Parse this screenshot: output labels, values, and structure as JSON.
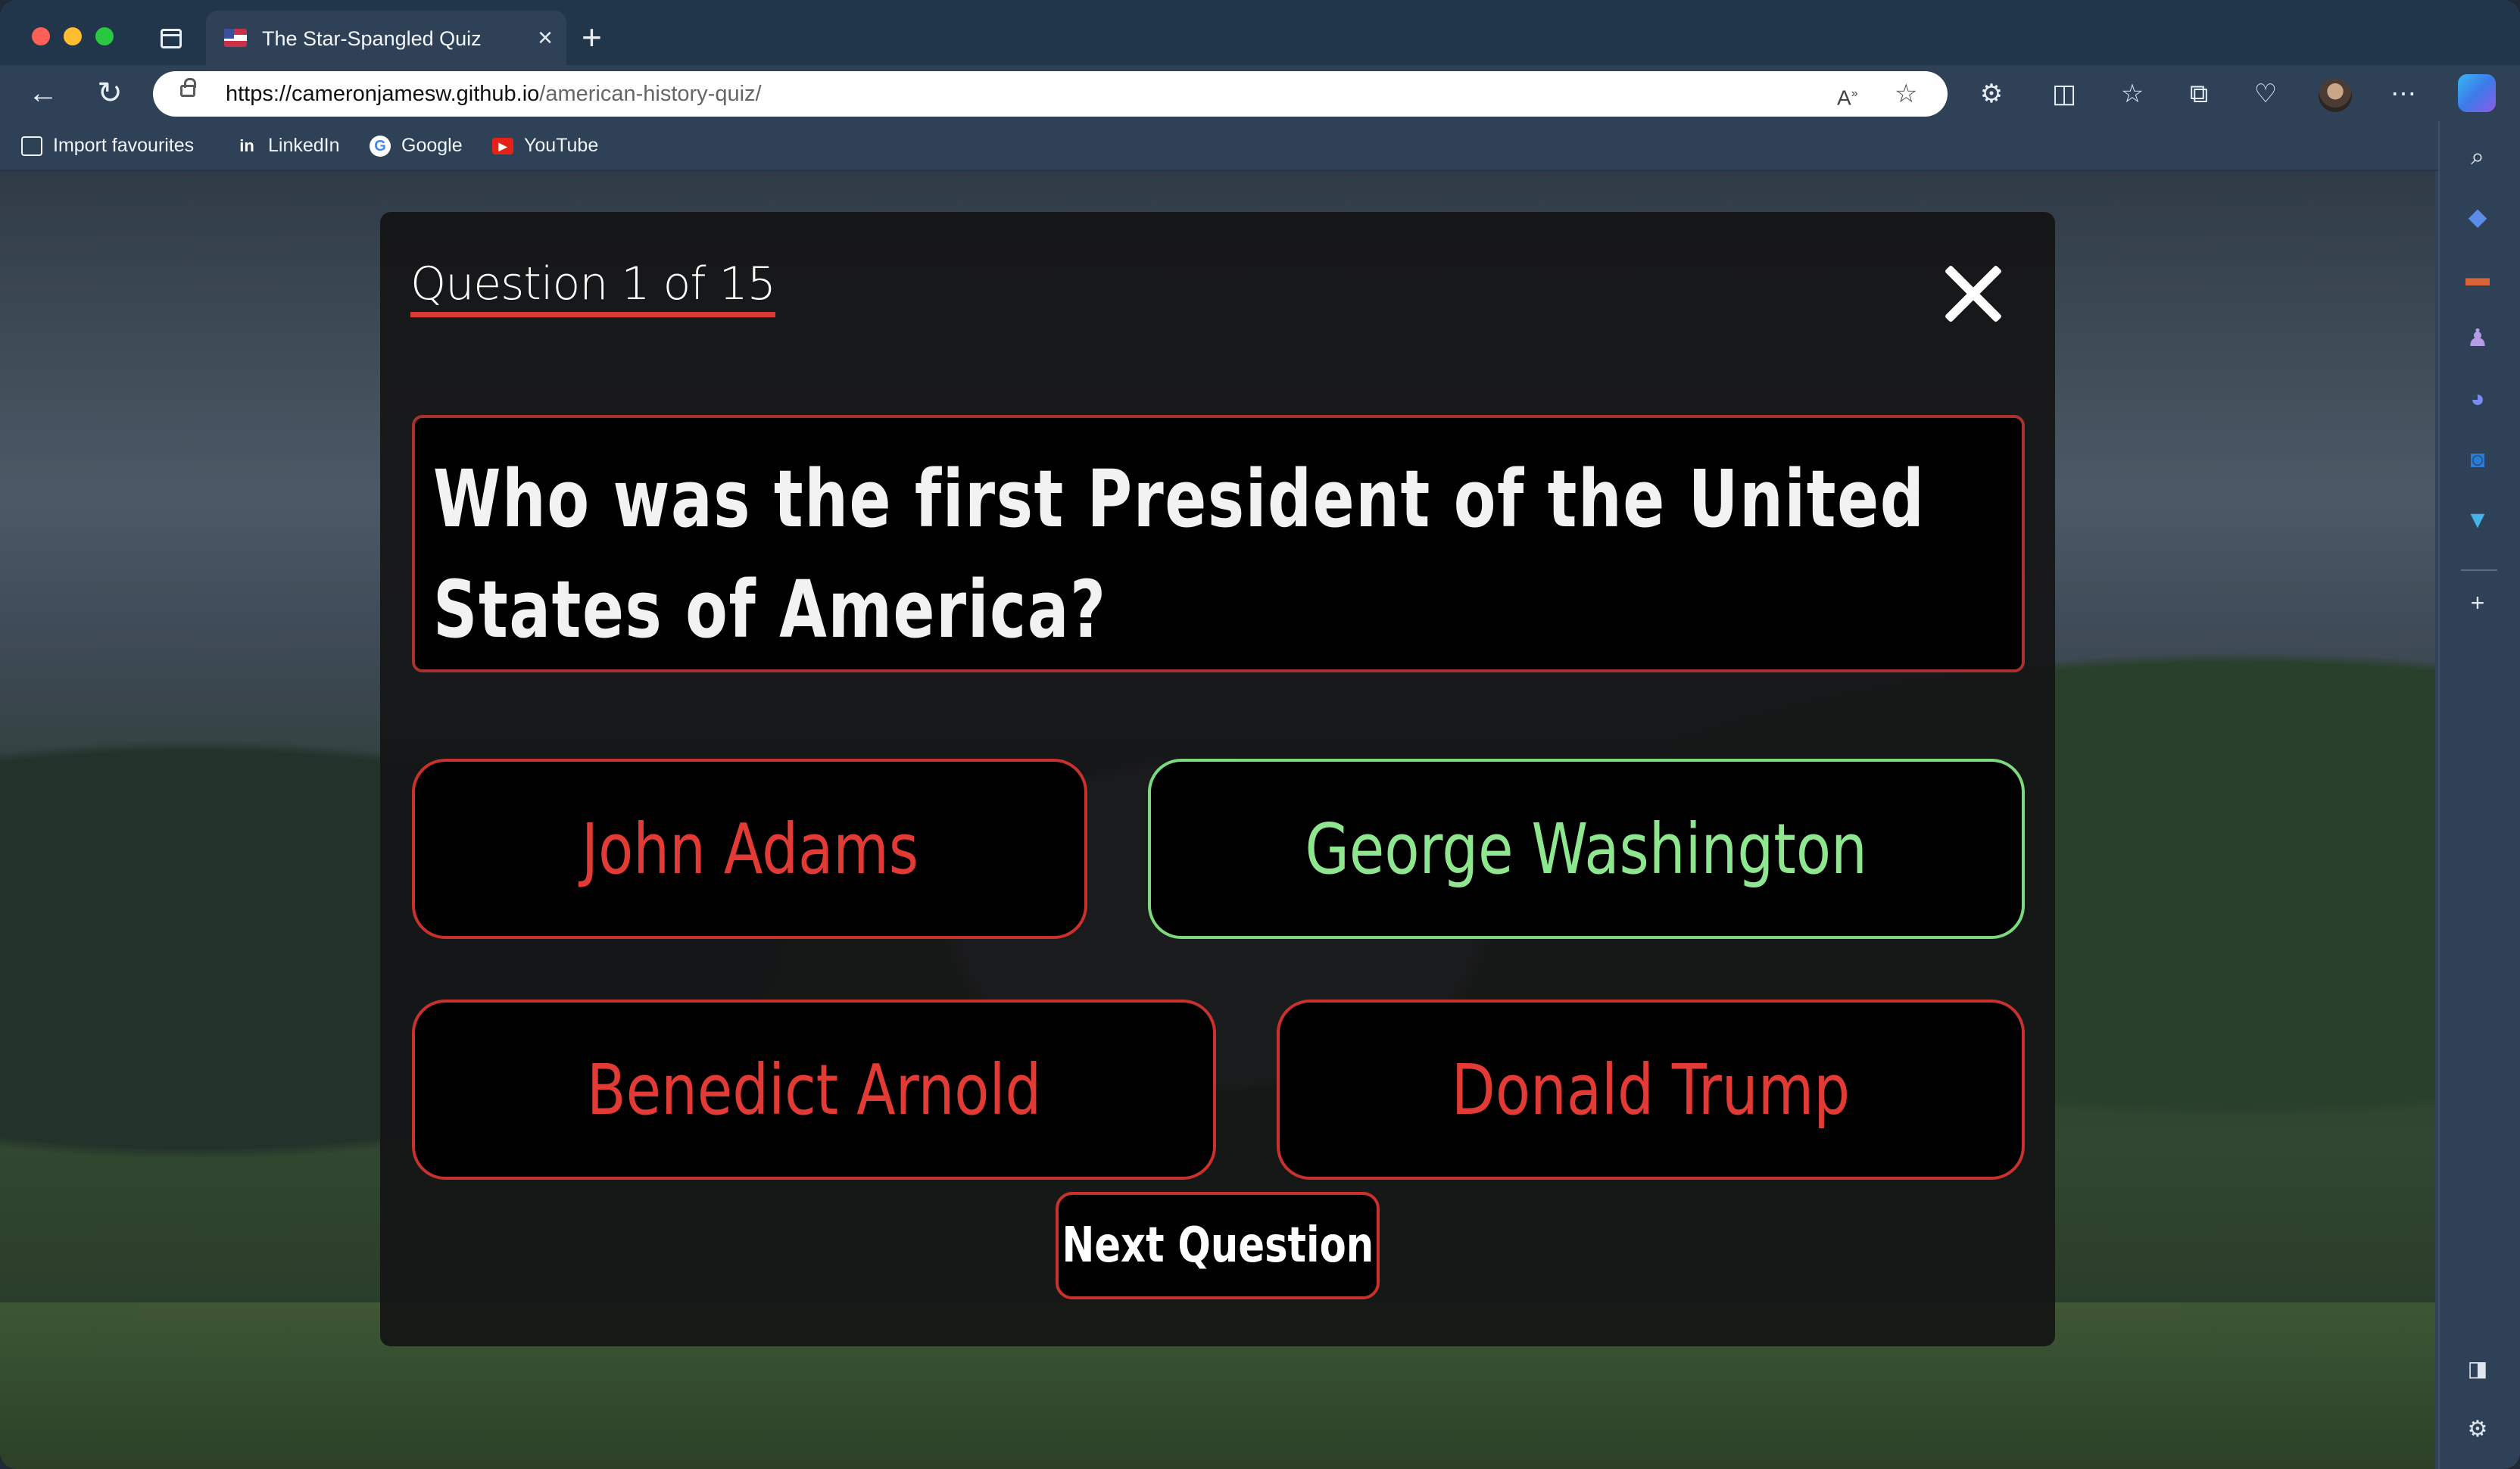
{
  "browser": {
    "tab_title": "The Star-Spangled Quiz",
    "tab_close": "×",
    "new_tab": "+",
    "url_host": "https://cameronjamesw.github.io",
    "url_path": "/american-history-quiz/",
    "bookmarks": [
      {
        "label": "Import favourites",
        "icon": "import-icon"
      },
      {
        "label": "LinkedIn",
        "icon": "linkedin-icon"
      },
      {
        "label": "Google",
        "icon": "google-icon"
      },
      {
        "label": "YouTube",
        "icon": "youtube-icon"
      }
    ],
    "colors": {
      "chrome": "#2f4157",
      "titlebar": "#22364b"
    }
  },
  "quiz": {
    "counter": "Question 1 of 15",
    "question": [
      "Who was the first President of the United",
      "States of America?"
    ],
    "answers": [
      {
        "label": "John Adams",
        "state": "incorrect"
      },
      {
        "label": "George Washington",
        "state": "correct"
      },
      {
        "label": "Benedict Arnold",
        "state": "incorrect"
      },
      {
        "label": "Donald Trump",
        "state": "incorrect"
      }
    ],
    "next_label": "Next Question",
    "colors": {
      "accent_red": "#d93a35",
      "correct_green": "#8ee68e",
      "panel": "#141416"
    }
  }
}
